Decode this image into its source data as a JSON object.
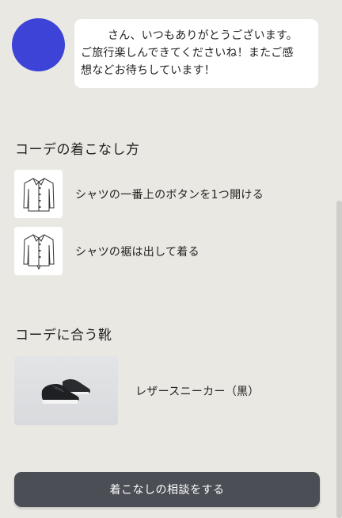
{
  "greeting": {
    "line1": "さん、いつもありがとうございます。",
    "line2": "ご旅行楽しんできてくださいね！またご感",
    "line3": "想などお待ちしています！"
  },
  "colors": {
    "avatar": "#3c43d6",
    "background": "#e9e8e3",
    "button": "#4b4f55"
  },
  "tips_section": {
    "title": "コーデの着こなし方",
    "items": [
      {
        "icon": "shirt-icon",
        "label": "シャツの一番上のボタンを1つ開ける"
      },
      {
        "icon": "shirt-icon",
        "label": "シャツの裾は出して着る"
      }
    ]
  },
  "shoes_section": {
    "title": "コーデに合う靴",
    "items": [
      {
        "icon": "sneaker-image",
        "label": "レザースニーカー（黒）"
      }
    ]
  },
  "cta": {
    "label": "着こなしの相談をする"
  }
}
